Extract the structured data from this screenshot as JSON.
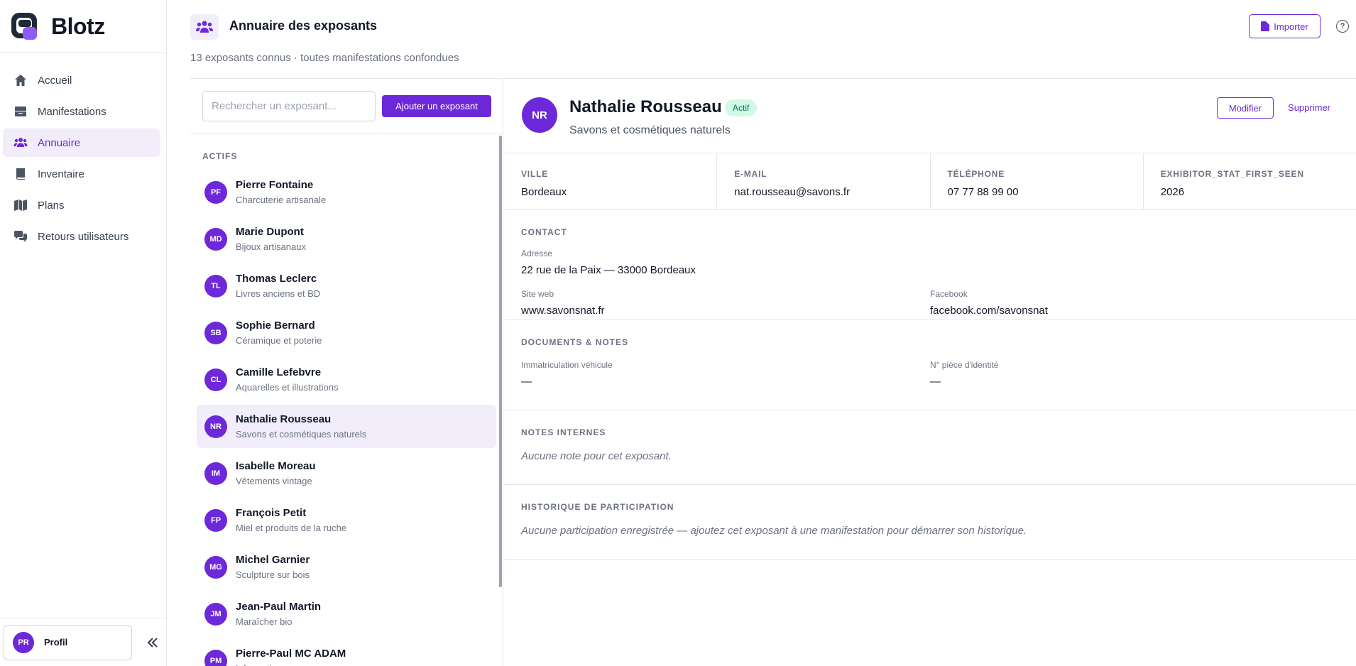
{
  "app": {
    "name": "Blotz"
  },
  "sidebar": {
    "items": [
      {
        "label": "Accueil",
        "icon": "home-icon"
      },
      {
        "label": "Manifestations",
        "icon": "inbox-icon"
      },
      {
        "label": "Annuaire",
        "icon": "users-icon",
        "active": true
      },
      {
        "label": "Inventaire",
        "icon": "book-icon"
      },
      {
        "label": "Plans",
        "icon": "map-icon"
      },
      {
        "label": "Retours utilisateurs",
        "icon": "chat-icon"
      }
    ],
    "profile": {
      "initials": "PR",
      "label": "Profil"
    }
  },
  "header": {
    "title": "Annuaire des exposants",
    "subtitle": "13 exposants connus · toutes manifestations confondues",
    "import_label": "Importer",
    "help_label": "?"
  },
  "list": {
    "search_placeholder": "Rechercher un exposant...",
    "add_label": "Ajouter un exposant",
    "section_label": "ACTIFS",
    "items": [
      {
        "initials": "PF",
        "name": "Pierre Fontaine",
        "category": "Charcuterie artisanale"
      },
      {
        "initials": "MD",
        "name": "Marie Dupont",
        "category": "Bijoux artisanaux"
      },
      {
        "initials": "TL",
        "name": "Thomas Leclerc",
        "category": "Livres anciens et BD"
      },
      {
        "initials": "SB",
        "name": "Sophie Bernard",
        "category": "Céramique et poterie"
      },
      {
        "initials": "CL",
        "name": "Camille Lefebvre",
        "category": "Aquarelles et illustrations"
      },
      {
        "initials": "NR",
        "name": "Nathalie Rousseau",
        "category": "Savons et cosmétiques naturels",
        "selected": true
      },
      {
        "initials": "IM",
        "name": "Isabelle Moreau",
        "category": "Vêtements vintage"
      },
      {
        "initials": "FP",
        "name": "François Petit",
        "category": "Miel et produits de la ruche"
      },
      {
        "initials": "MG",
        "name": "Michel Garnier",
        "category": "Sculpture sur bois"
      },
      {
        "initials": "JM",
        "name": "Jean-Paul Martin",
        "category": "Maraîcher bio"
      },
      {
        "initials": "PM",
        "name": "Pierre-Paul MC ADAM",
        "category": "Informatique"
      }
    ]
  },
  "detail": {
    "initials": "NR",
    "name": "Nathalie Rousseau",
    "status": "Actif",
    "category": "Savons et cosmétiques naturels",
    "edit_label": "Modifier",
    "delete_label": "Supprimer",
    "stats": [
      {
        "label": "VILLE",
        "value": "Bordeaux"
      },
      {
        "label": "E-MAIL",
        "value": "nat.rousseau@savons.fr"
      },
      {
        "label": "TÉLÉPHONE",
        "value": "07 77 88 99 00"
      },
      {
        "label": "EXHIBITOR_STAT_FIRST_SEEN",
        "value": "2026"
      }
    ],
    "contact": {
      "title": "CONTACT",
      "address_label": "Adresse",
      "address": "22 rue de la Paix — 33000 Bordeaux",
      "website_label": "Site web",
      "website": "www.savonsnat.fr",
      "facebook_label": "Facebook",
      "facebook": "facebook.com/savonsnat"
    },
    "documents": {
      "title": "DOCUMENTS & NOTES",
      "plate_label": "Immatriculation véhicule",
      "plate": "—",
      "id_label": "N° pièce d'identité",
      "id": "—"
    },
    "notes": {
      "title": "NOTES INTERNES",
      "text": "Aucune note pour cet exposant."
    },
    "history": {
      "title": "HISTORIQUE DE PARTICIPATION",
      "text": "Aucune participation enregistrée — ajoutez cet exposant à une manifestation pour démarrer son historique."
    }
  },
  "colors": {
    "accent": "#6d28d9",
    "accent_light": "#f1edfb",
    "badge_bg": "#d1fae5",
    "badge_text": "#047857"
  }
}
